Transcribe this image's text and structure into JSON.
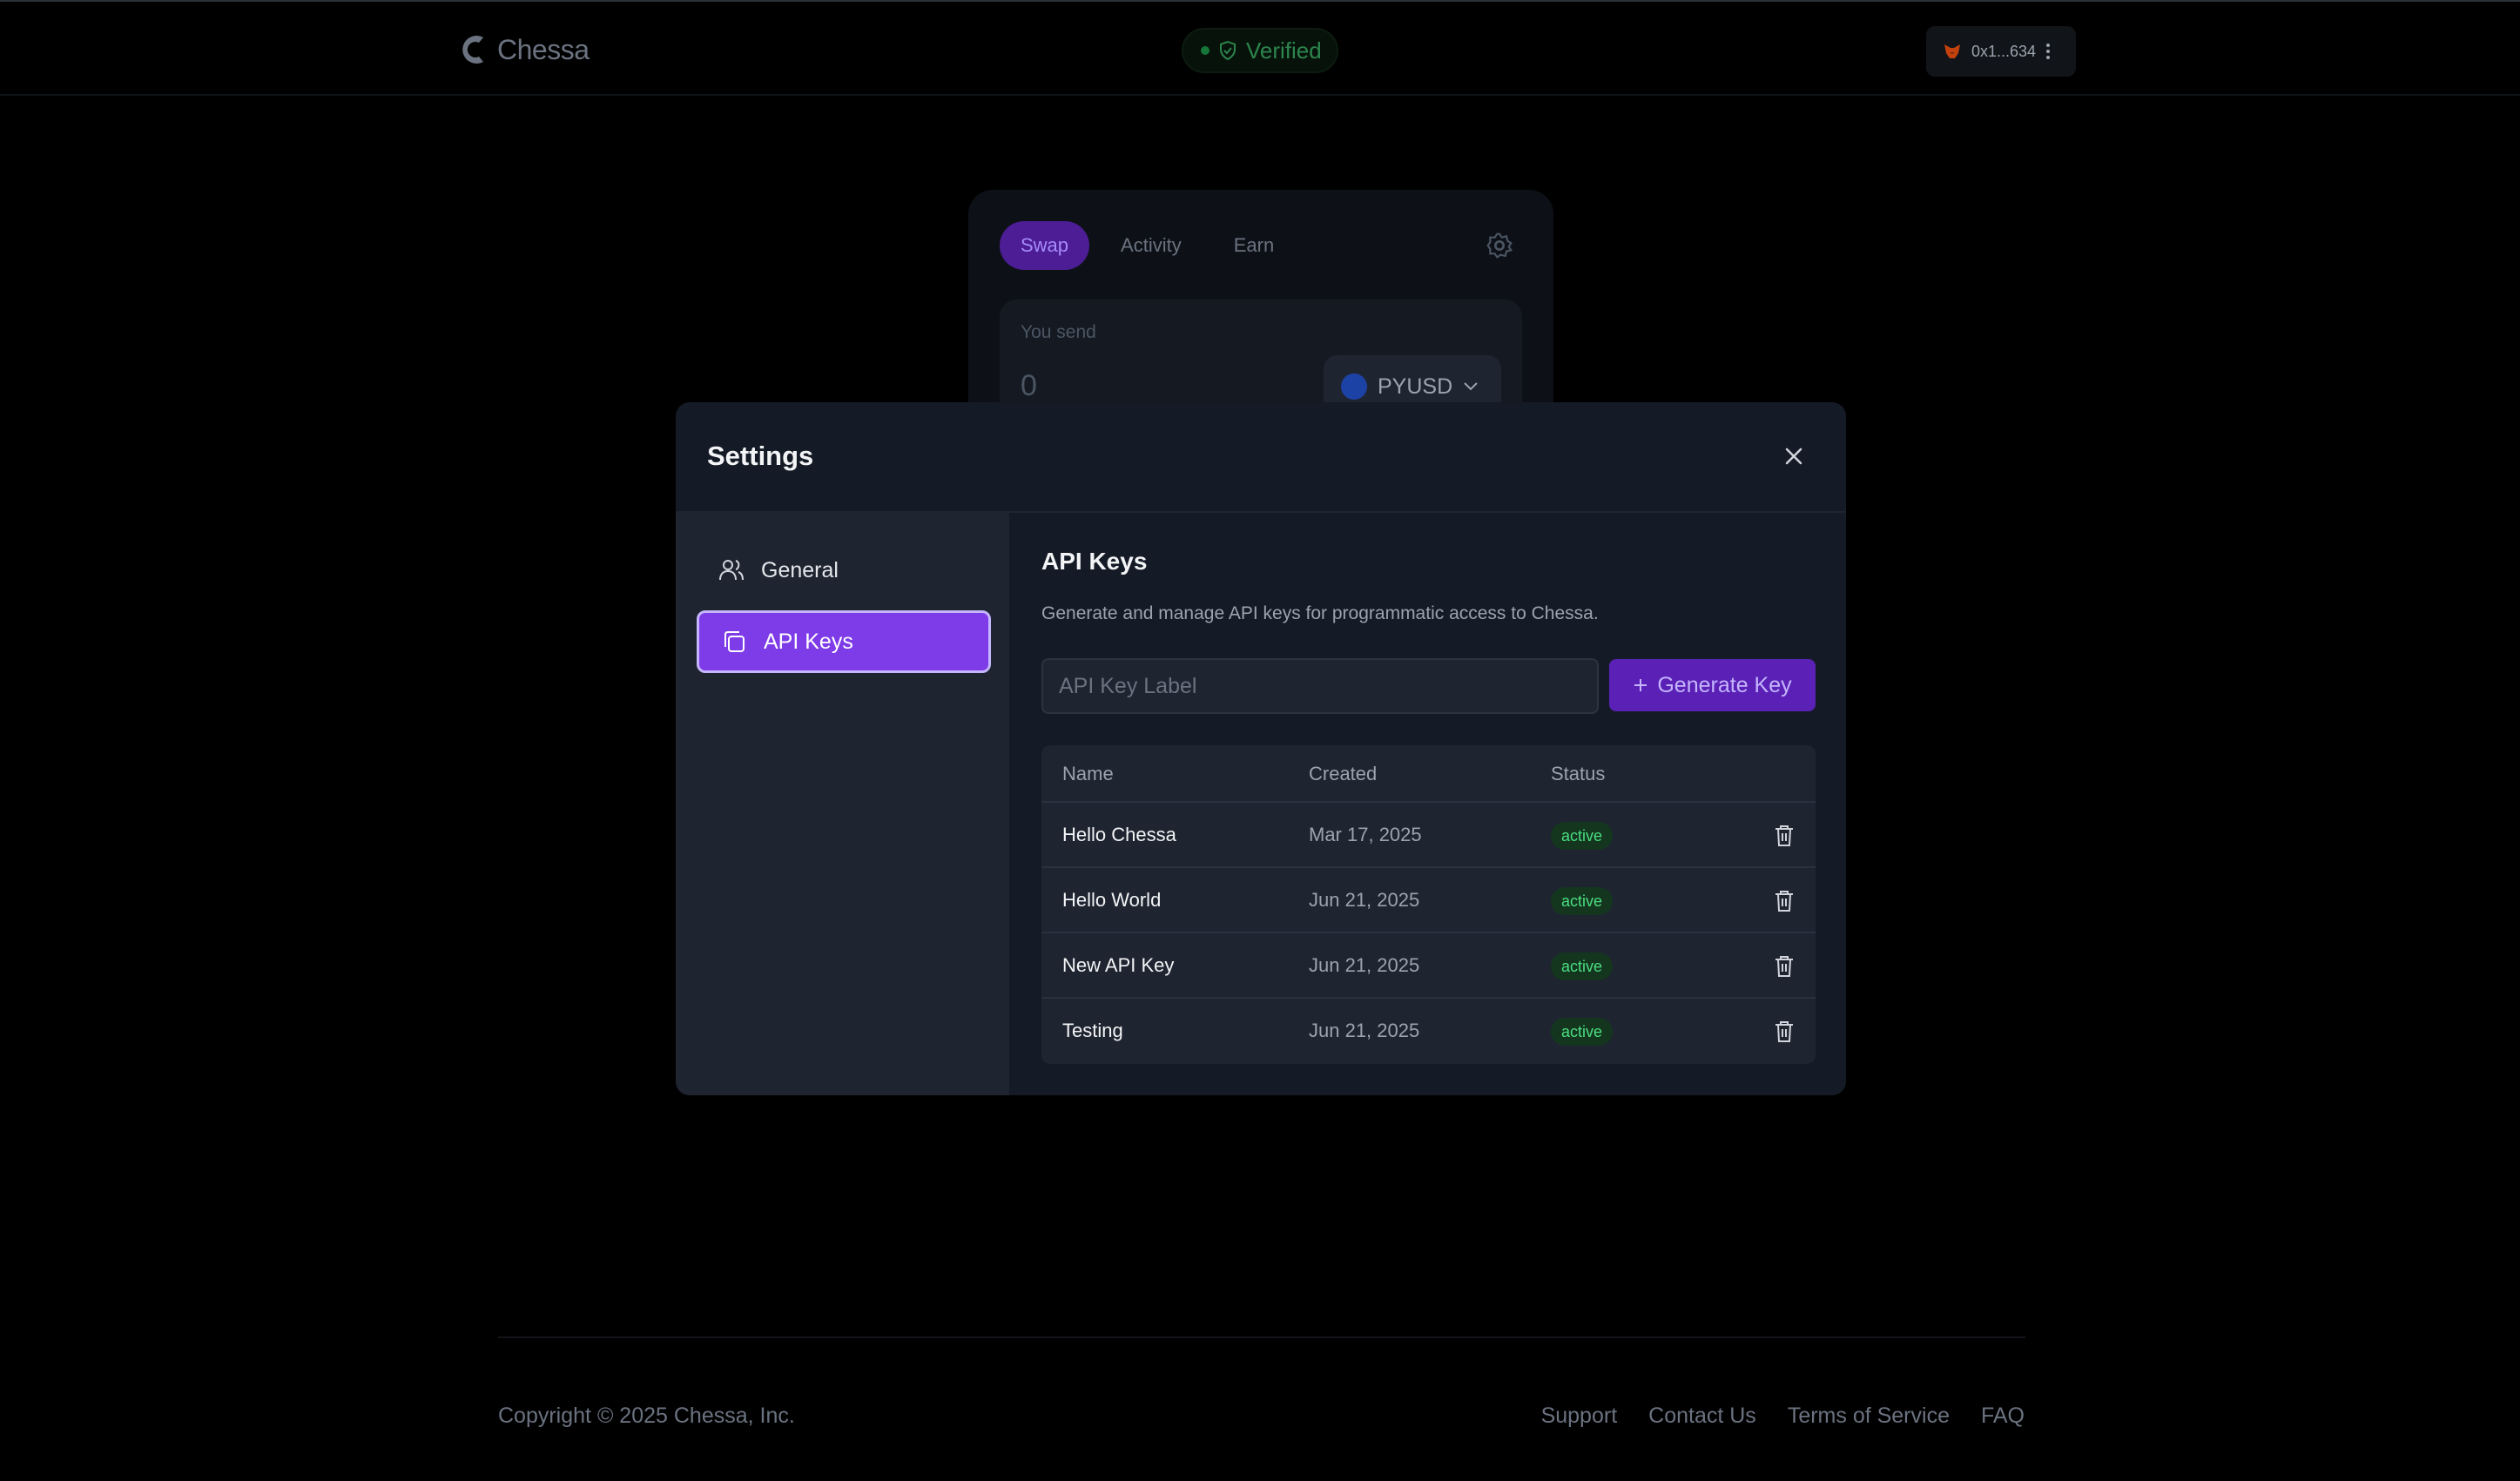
{
  "header": {
    "brand": "Chessa",
    "verified_label": "Verified",
    "wallet_address": "0x1...634"
  },
  "swap_card": {
    "tabs": [
      "Swap",
      "Activity",
      "Earn"
    ],
    "send_label": "You send",
    "send_value": "0",
    "token": "PYUSD"
  },
  "settings": {
    "title": "Settings",
    "nav": {
      "general": "General",
      "api_keys": "API Keys"
    },
    "api_keys": {
      "title": "API Keys",
      "description": "Generate and manage API keys for programmatic access to Chessa.",
      "input_placeholder": "API Key Label",
      "generate_label": "Generate Key",
      "columns": [
        "Name",
        "Created",
        "Status"
      ],
      "rows": [
        {
          "name": "Hello Chessa",
          "created": "Mar 17, 2025",
          "status": "active"
        },
        {
          "name": "Hello World",
          "created": "Jun 21, 2025",
          "status": "active"
        },
        {
          "name": "New API Key",
          "created": "Jun 21, 2025",
          "status": "active"
        },
        {
          "name": "Testing",
          "created": "Jun 21, 2025",
          "status": "active"
        }
      ]
    }
  },
  "footer": {
    "copyright": "Copyright © 2025 Chessa, Inc.",
    "links": [
      "Support",
      "Contact Us",
      "Terms of Service",
      "FAQ"
    ]
  },
  "colors": {
    "accent": "#7e3be8",
    "status_active": "#4ade80",
    "background": "#000000",
    "modal": "#151b26"
  }
}
